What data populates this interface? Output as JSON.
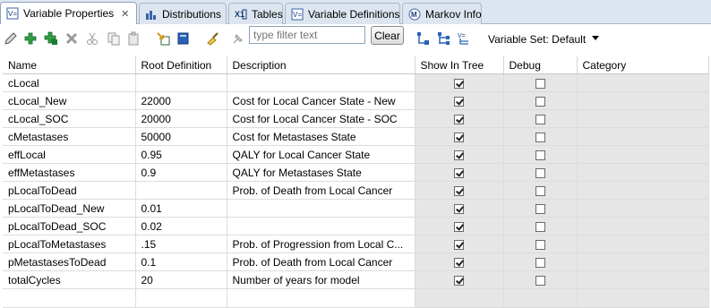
{
  "tabs": [
    {
      "label": "Variable Properties",
      "icon": "variable-properties-icon",
      "active": true,
      "closable": true
    },
    {
      "label": "Distributions",
      "icon": "distributions-icon"
    },
    {
      "label": "Tables",
      "icon": "tables-icon"
    },
    {
      "label": "Variable Definitions",
      "icon": "variable-definitions-icon"
    },
    {
      "label": "Markov Info",
      "icon": "markov-info-icon"
    }
  ],
  "toolbar": {
    "filter_placeholder": "type filter text",
    "clear_label": "Clear",
    "variable_set_label": "Variable Set: Default"
  },
  "table": {
    "columns": [
      "Name",
      "Root Definition",
      "Description",
      "Show In Tree",
      "Debug",
      "Category"
    ],
    "rows": [
      {
        "name": "cLocal",
        "root": "",
        "desc": "",
        "show": true,
        "debug": false
      },
      {
        "name": "cLocal_New",
        "root": "22000",
        "desc": "Cost for Local Cancer State - New",
        "show": true,
        "debug": false
      },
      {
        "name": "cLocal_SOC",
        "root": "20000",
        "desc": "Cost for Local Cancer State - SOC",
        "show": true,
        "debug": false
      },
      {
        "name": "cMetastases",
        "root": "50000",
        "desc": "Cost for Metastases State",
        "show": true,
        "debug": false
      },
      {
        "name": "effLocal",
        "root": "0.95",
        "desc": "QALY for Local Cancer State",
        "show": true,
        "debug": false
      },
      {
        "name": "effMetastases",
        "root": "0.9",
        "desc": "QALY for Metastases State",
        "show": true,
        "debug": false
      },
      {
        "name": "pLocalToDead",
        "root": "",
        "desc": "Prob. of Death from Local Cancer",
        "show": true,
        "debug": false
      },
      {
        "name": "pLocalToDead_New",
        "root": "0.01",
        "desc": "",
        "show": true,
        "debug": false
      },
      {
        "name": "pLocalToDead_SOC",
        "root": "0.02",
        "desc": "",
        "show": true,
        "debug": false
      },
      {
        "name": "pLocalToMetastases",
        "root": ".15",
        "desc": "Prob. of Progression from Local C...",
        "show": true,
        "debug": false
      },
      {
        "name": "pMetastasesToDead",
        "root": "0.1",
        "desc": "Prob. of Death from Local Cancer",
        "show": true,
        "debug": false
      },
      {
        "name": "totalCycles",
        "root": "20",
        "desc": "Number of years for model",
        "show": true,
        "debug": false
      }
    ]
  }
}
